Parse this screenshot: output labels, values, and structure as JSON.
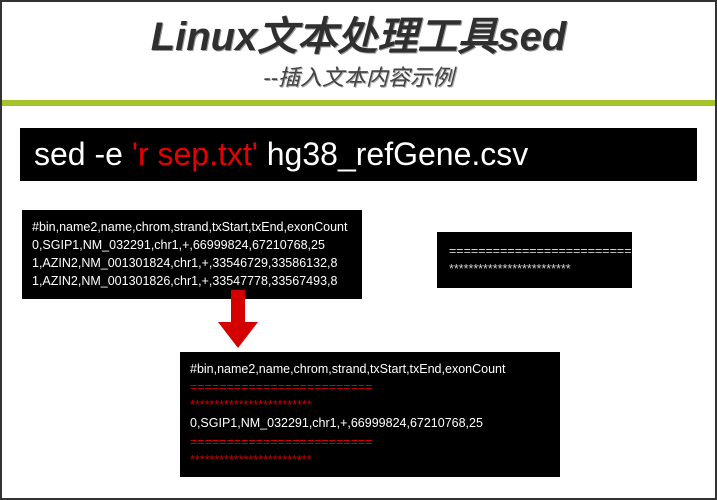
{
  "header": {
    "title": "Linux文本处理工具sed",
    "subtitle": "--插入文本内容示例"
  },
  "command": {
    "prefix": "sed -e ",
    "red": "'r sep.txt'",
    "suffix": " hg38_refGene.csv"
  },
  "input_box": {
    "l1": "#bin,name2,name,chrom,strand,txStart,txEnd,exonCount",
    "l2": "0,SGIP1,NM_032291,chr1,+,66999824,67210768,25",
    "l3": "1,AZIN2,NM_001301824,chr1,+,33546729,33586132,8",
    "l4": "1,AZIN2,NM_001301826,chr1,+,33547778,33567493,8"
  },
  "sep_box": {
    "l1": "=========================",
    "l2": "*************************"
  },
  "output_box": {
    "l1": "#bin,name2,name,chrom,strand,txStart,txEnd,exonCount",
    "l2": "=========================",
    "l3": "*************************",
    "l4": "0,SGIP1,NM_032291,chr1,+,66999824,67210768,25",
    "l5": "=========================",
    "l6": "*************************"
  }
}
